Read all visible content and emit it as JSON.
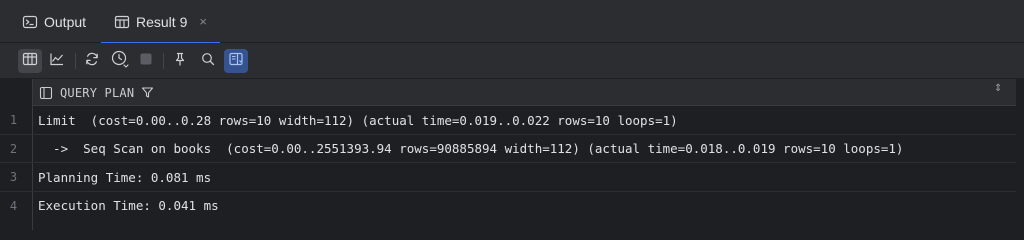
{
  "tabs": [
    {
      "label": "Output",
      "icon": "terminal-icon",
      "active": false,
      "closable": false
    },
    {
      "label": "Result 9",
      "icon": "table-icon",
      "active": true,
      "closable": true,
      "close_glyph": "×"
    }
  ],
  "toolbar": {
    "buttons": [
      "table-view-icon",
      "chart-view-icon",
      "refresh-icon",
      "history-clock-icon",
      "stop-icon",
      "pin-icon",
      "search-icon",
      "value-editor-icon"
    ]
  },
  "grid": {
    "column_header": "QUERY PLAN",
    "sort_glyph": "⇕",
    "rows": [
      {
        "num": "1",
        "value": "Limit  (cost=0.00..0.28 rows=10 width=112) (actual time=0.019..0.022 rows=10 loops=1)"
      },
      {
        "num": "2",
        "value": "  ->  Seq Scan on books  (cost=0.00..2551393.94 rows=90885894 width=112) (actual time=0.018..0.019 rows=10 loops=1)"
      },
      {
        "num": "3",
        "value": "Planning Time: 0.081 ms"
      },
      {
        "num": "4",
        "value": "Execution Time: 0.041 ms"
      }
    ]
  },
  "colors": {
    "background": "#1e1f22",
    "panel": "#2b2d30",
    "accent": "#3574f0",
    "text": "#dfe1e5",
    "muted": "#6f737a"
  }
}
